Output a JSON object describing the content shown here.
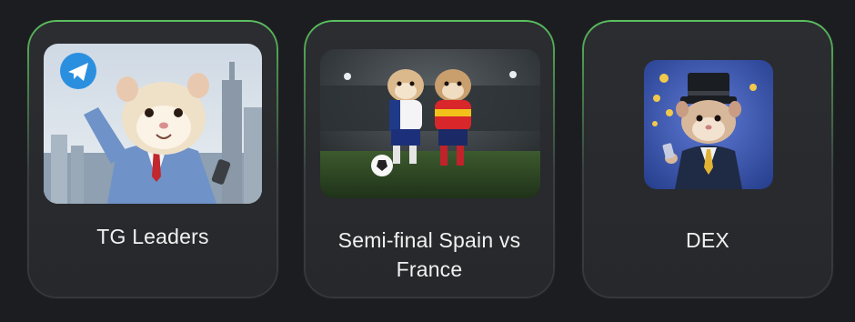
{
  "cards": [
    {
      "title": "TG Leaders",
      "image_icon": "hamster-businessman-telegram-icon"
    },
    {
      "title": "Semi-final Spain vs France",
      "image_icon": "hamsters-football-match-icon"
    },
    {
      "title": "DEX",
      "image_icon": "hamster-top-hat-coins-icon"
    }
  ],
  "colors": {
    "background": "#1c1d20",
    "card_background": "#2a2c30",
    "card_border_accent": "#5bbf5f",
    "text": "#f1f1f1"
  }
}
